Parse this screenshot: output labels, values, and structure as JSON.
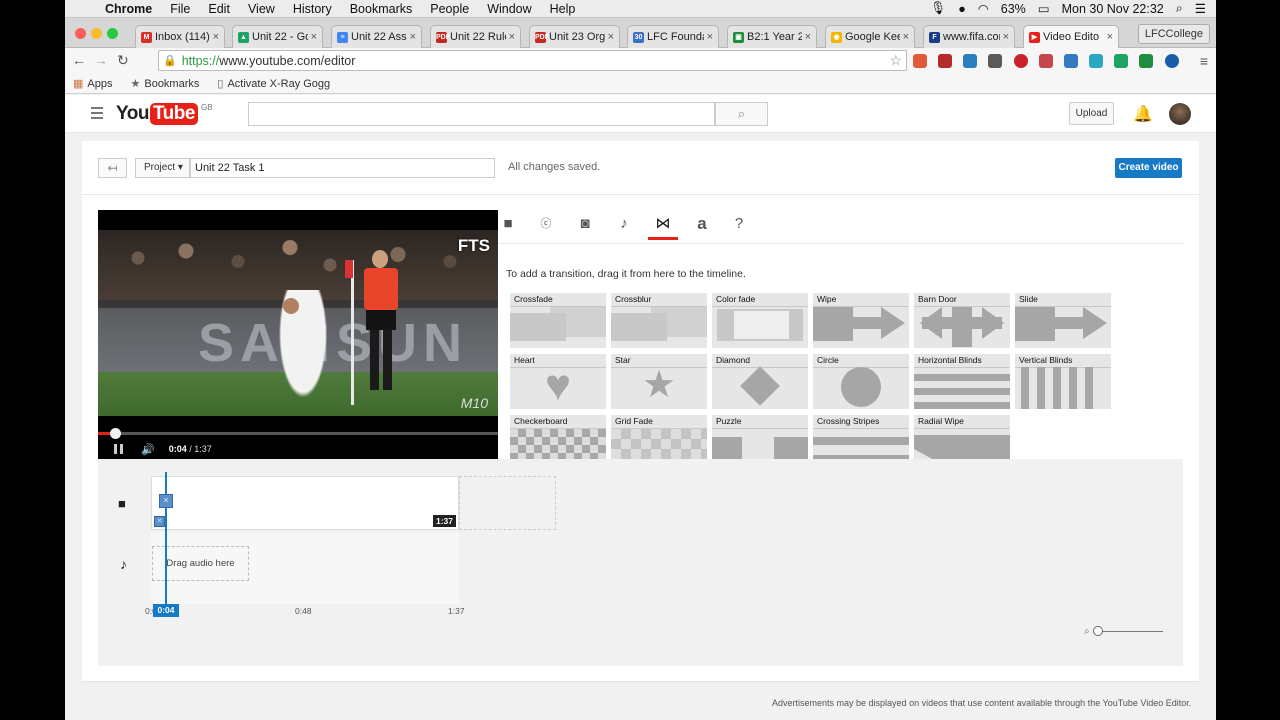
{
  "menubar": {
    "items": [
      "Chrome",
      "File",
      "Edit",
      "View",
      "History",
      "Bookmarks",
      "People",
      "Window",
      "Help"
    ],
    "battery": "63%",
    "datetime": "Mon 30 Nov  22:32"
  },
  "tabs": [
    {
      "label": "Inbox (114) -",
      "favicon": "M",
      "color": "#d93025"
    },
    {
      "label": "Unit 22 - Goo",
      "favicon": "▲",
      "color": "#1fa463"
    },
    {
      "label": "Unit 22 Asses",
      "favicon": "≡",
      "color": "#4285f4"
    },
    {
      "label": "Unit 22 Rules",
      "favicon": "PDF",
      "color": "#c5281c"
    },
    {
      "label": "Unit 23 Organ",
      "favicon": "PDF",
      "color": "#c5281c"
    },
    {
      "label": "LFC Foundatio",
      "favicon": "30",
      "color": "#3b6fc9"
    },
    {
      "label": "B2:1 Year 2 B",
      "favicon": "▣",
      "color": "#1e8e3e"
    },
    {
      "label": "Google Keep",
      "favicon": "◉",
      "color": "#f4b400"
    },
    {
      "label": "www.fifa.com",
      "favicon": "F",
      "color": "#1a3c8a"
    },
    {
      "label": "Video Edito",
      "favicon": "▶",
      "color": "#e62117"
    }
  ],
  "profile": "LFCCollege",
  "address": {
    "scheme": "https://",
    "rest": "www.youtube.com/editor"
  },
  "bookmarks": {
    "apps": "Apps",
    "bookmarks": "Bookmarks",
    "xray": "Activate X-Ray Gogg"
  },
  "youtube": {
    "logo_you": "You",
    "logo_tube": "Tube",
    "region": "GB",
    "search_placeholder": "",
    "upload": "Upload"
  },
  "editor": {
    "project_btn": "Project",
    "project_name": "Unit 22 Task 1",
    "status": "All changes saved.",
    "create": "Create video",
    "hint": "To add a transition, drag it from here to the timeline.",
    "overlay_tag": "FTS",
    "overlay_mark": "M10",
    "time_current": "0:04",
    "time_total": " / 1:37",
    "playback_progress": 0.042
  },
  "transitions": [
    "Crossfade",
    "Crossblur",
    "Color fade",
    "Wipe",
    "Barn Door",
    "Slide",
    "Heart",
    "Star",
    "Diamond",
    "Circle",
    "Horizontal Blinds",
    "Vertical Blinds",
    "Checkerboard",
    "Grid Fade",
    "Puzzle",
    "Crossing Stripes",
    "Radial Wipe"
  ],
  "timeline": {
    "clip_duration": "1:37",
    "drag_audio": "Drag audio here",
    "ruler_start": "0:0",
    "ruler_mid": "0:48",
    "ruler_end": "1:37",
    "playhead_time": "0:04"
  },
  "footer": "Advertisements may be displayed on videos that use content available through the YouTube Video Editor.",
  "colors": {
    "accent": "#167ac6",
    "youtube_red": "#e62117"
  }
}
